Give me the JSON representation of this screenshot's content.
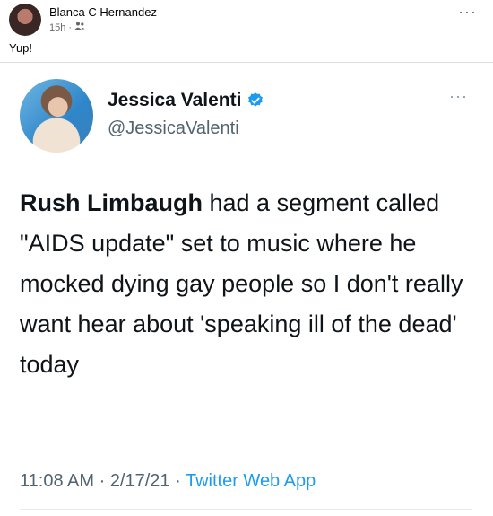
{
  "post": {
    "author": "Blanca C Hernandez",
    "time": "15h",
    "separator": "·",
    "audience_icon": "friends-icon",
    "more_icon": "···",
    "caption": "Yup!"
  },
  "tweet": {
    "display_name": "Jessica Valenti",
    "verified_icon": "verified-badge-icon",
    "handle": "@JessicaValenti",
    "more_icon": "···",
    "text_bold": "Rush Limbaugh",
    "text_rest": " had a segment called \"AIDS update\" set to music where he mocked dying gay people so I don't really want hear about 'speaking ill of the dead' today",
    "time": "11:08 AM",
    "sep1": " · ",
    "date": "2/17/21",
    "sep2": " · ",
    "source": "Twitter Web App"
  },
  "colors": {
    "link": "#1d9bf0",
    "verified": "#1d9bf0",
    "muted": "#536471"
  }
}
